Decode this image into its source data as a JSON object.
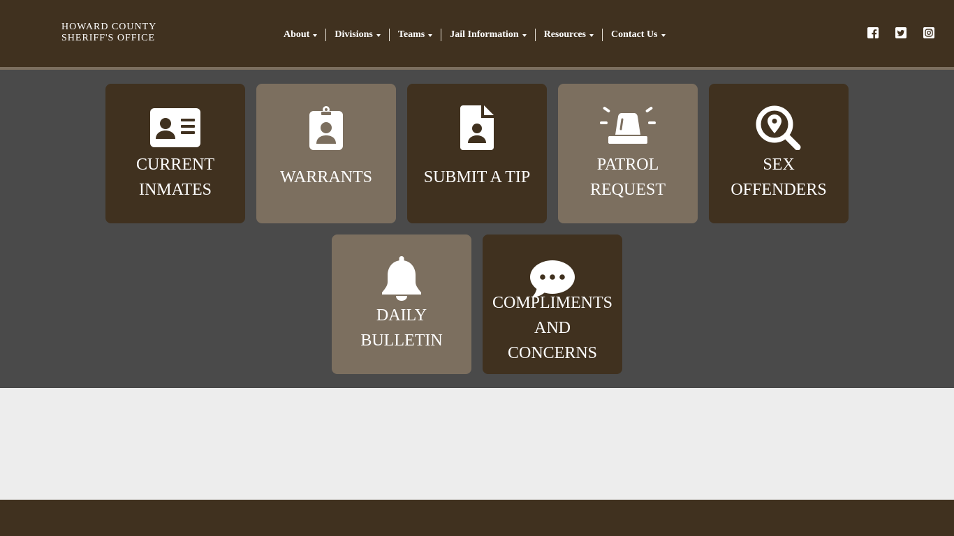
{
  "header": {
    "logo_line1": "HOWARD COUNTY",
    "logo_line2": "SHERIFF'S OFFICE",
    "nav": [
      {
        "label": "About"
      },
      {
        "label": "Divisions"
      },
      {
        "label": "Teams"
      },
      {
        "label": "Jail Information"
      },
      {
        "label": "Resources"
      },
      {
        "label": "Contact Us"
      }
    ],
    "social": [
      "facebook-icon",
      "twitter-icon",
      "instagram-icon"
    ]
  },
  "tiles": [
    {
      "line1": "CURRENT",
      "line2": "INMATES",
      "icon": "id-card-icon"
    },
    {
      "line1": "WARRANTS",
      "icon": "badge-id-icon"
    },
    {
      "line1": "SUBMIT A TIP",
      "icon": "file-user-icon"
    },
    {
      "line1": "PATROL",
      "line2": "REQUEST",
      "icon": "siren-icon"
    },
    {
      "line1": "SEX",
      "line2": "OFFENDERS",
      "icon": "search-location-icon"
    },
    {
      "line1": "DAILY",
      "line2": "BULLETIN",
      "icon": "bell-icon"
    },
    {
      "line1": "COMPLIMENTS",
      "line2": "AND",
      "line3": "CONCERNS",
      "icon": "speech-bubble-icon"
    }
  ],
  "colors": {
    "brand_dark": "#40311f",
    "brand_light": "#7c6f5f",
    "tile_area_bg": "#4a4a4a",
    "page_bg": "#ededed"
  }
}
